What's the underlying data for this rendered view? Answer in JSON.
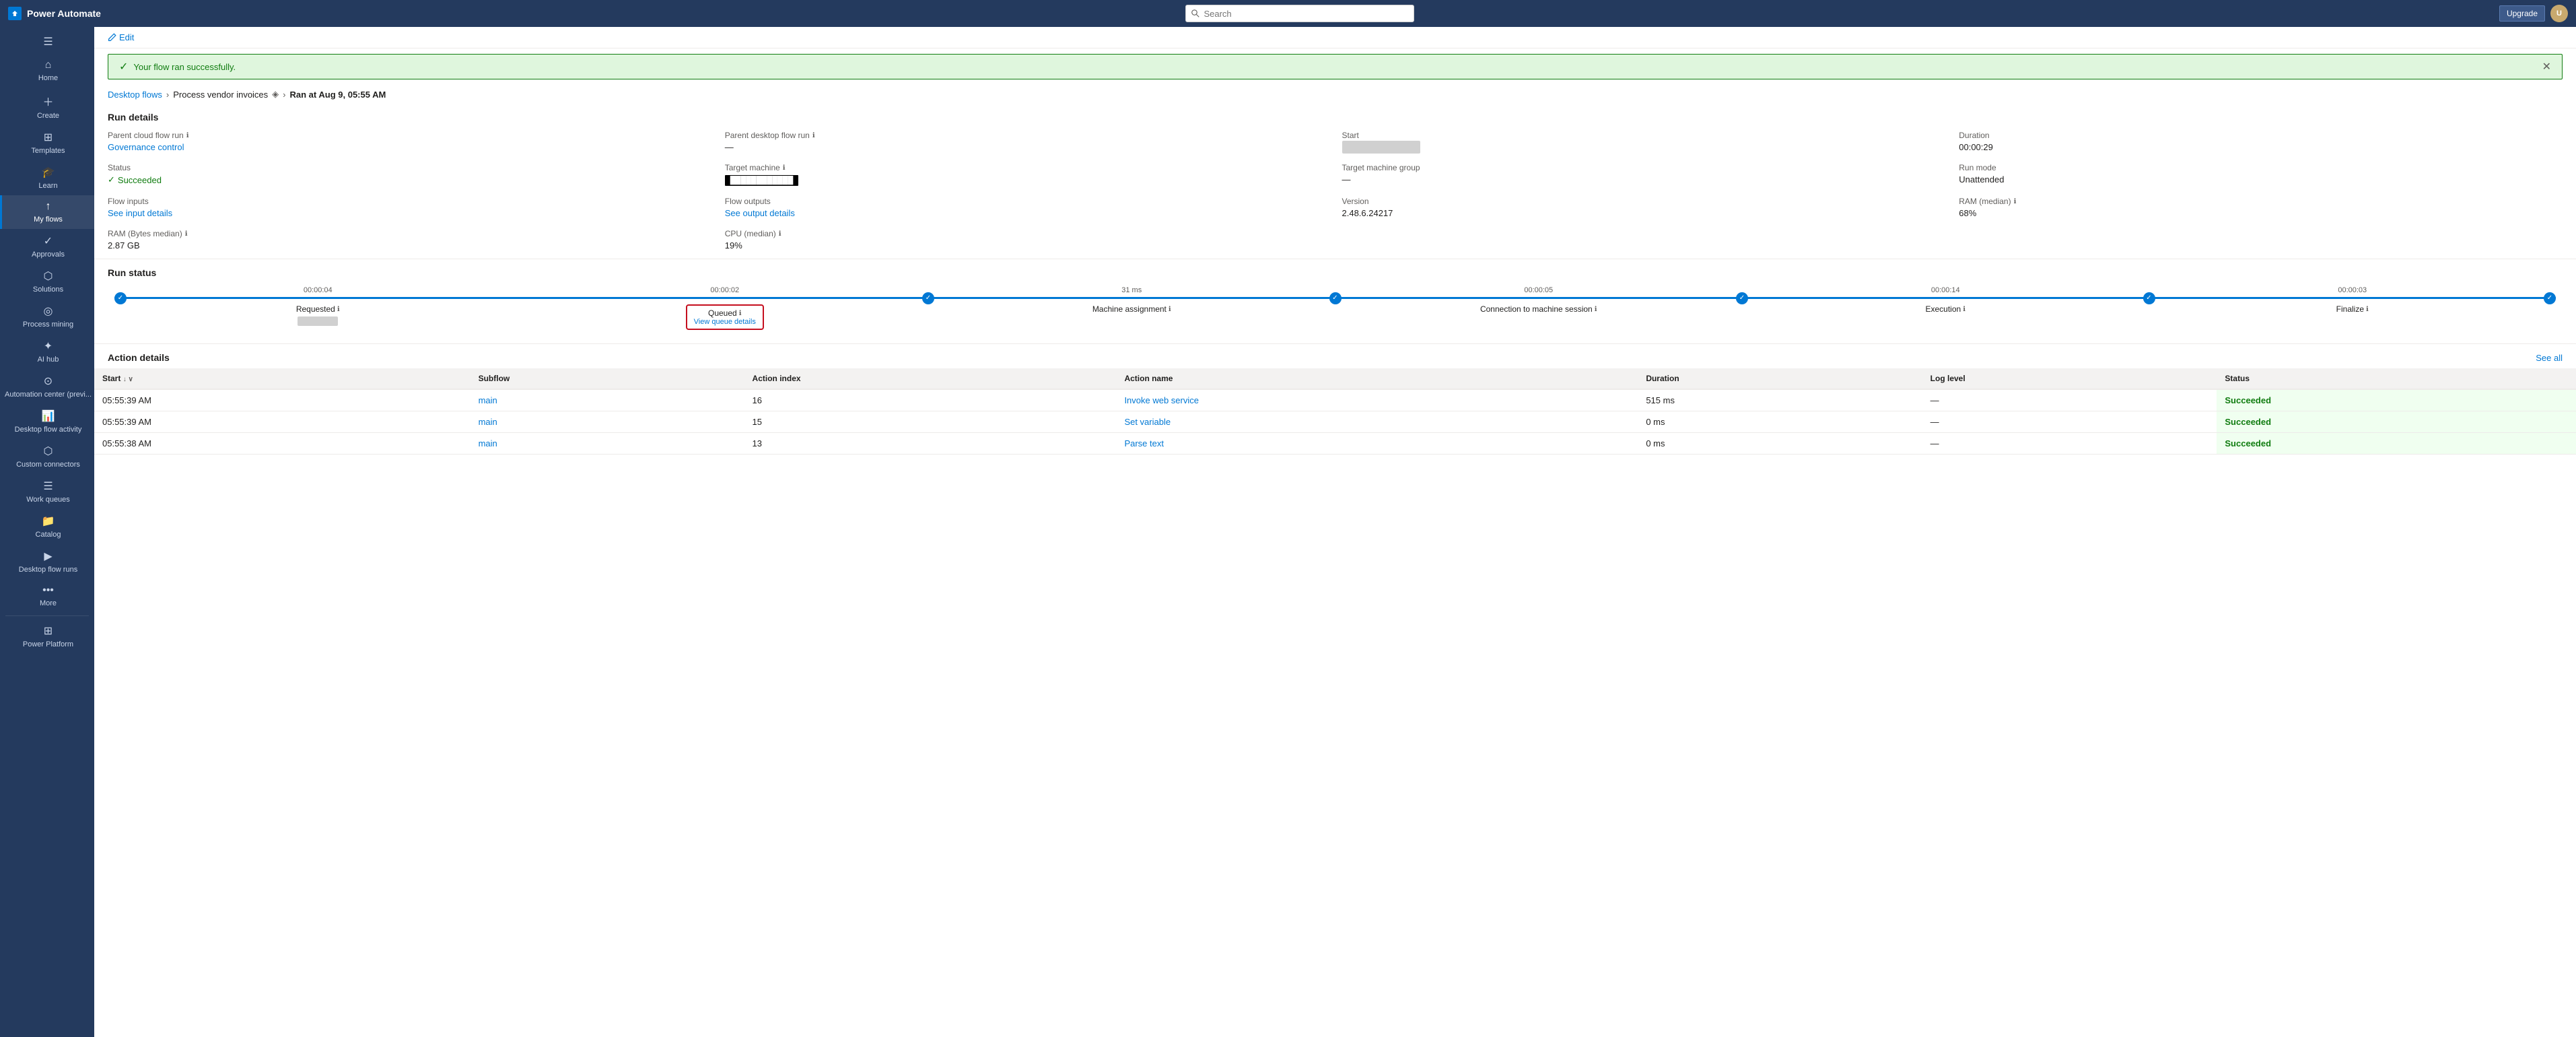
{
  "topbar": {
    "app_name": "Power Automate",
    "search_placeholder": "Search",
    "upgrade_btn": "Upgrade",
    "avatar_initials": "U"
  },
  "sidebar": {
    "items": [
      {
        "id": "menu",
        "icon": "☰",
        "label": ""
      },
      {
        "id": "home",
        "icon": "⌂",
        "label": "Home"
      },
      {
        "id": "create",
        "icon": "+",
        "label": "Create"
      },
      {
        "id": "templates",
        "icon": "⊞",
        "label": "Templates"
      },
      {
        "id": "learn",
        "icon": "🎓",
        "label": "Learn"
      },
      {
        "id": "my-flows",
        "icon": "↑",
        "label": "My flows",
        "active": true
      },
      {
        "id": "approvals",
        "icon": "✓",
        "label": "Approvals"
      },
      {
        "id": "solutions",
        "icon": "⬡",
        "label": "Solutions"
      },
      {
        "id": "process-mining",
        "icon": "◎",
        "label": "Process mining"
      },
      {
        "id": "ai-hub",
        "icon": "✦",
        "label": "AI hub"
      },
      {
        "id": "automation-center",
        "icon": "⊙",
        "label": "Automation center (previ..."
      },
      {
        "id": "desktop-flow-activity",
        "icon": "📊",
        "label": "Desktop flow activity"
      },
      {
        "id": "custom-connectors",
        "icon": "⬡",
        "label": "Custom connectors"
      },
      {
        "id": "work-queues",
        "icon": "☰",
        "label": "Work queues"
      },
      {
        "id": "catalog",
        "icon": "📁",
        "label": "Catalog"
      },
      {
        "id": "desktop-flow-runs",
        "icon": "▶",
        "label": "Desktop flow runs"
      },
      {
        "id": "more",
        "icon": "•••",
        "label": "More"
      },
      {
        "id": "power-platform",
        "icon": "⊞",
        "label": "Power Platform"
      }
    ]
  },
  "edit_bar": {
    "edit_label": "Edit"
  },
  "success_banner": {
    "message": "Your flow ran successfully."
  },
  "breadcrumb": {
    "parent": "Desktop flows",
    "flow_name": "Process vendor invoices",
    "run_label": "Ran at Aug 9, 05:55 AM"
  },
  "run_details": {
    "section_title": "Run details",
    "parent_cloud_flow_run_label": "Parent cloud flow run",
    "parent_cloud_flow_run_value": "Governance control",
    "parent_desktop_flow_run_label": "Parent desktop flow run",
    "parent_desktop_flow_run_value": "—",
    "start_label": "Start",
    "start_value": "████████████",
    "duration_label": "Duration",
    "duration_value": "00:00:29",
    "status_label": "Status",
    "status_value": "Succeeded",
    "target_machine_label": "Target machine",
    "target_machine_value": "████████████",
    "target_machine_group_label": "Target machine group",
    "target_machine_group_value": "—",
    "run_mode_label": "Run mode",
    "run_mode_value": "Unattended",
    "flow_inputs_label": "Flow inputs",
    "flow_inputs_link": "See input details",
    "flow_outputs_label": "Flow outputs",
    "flow_outputs_link": "See output details",
    "version_label": "Version",
    "version_value": "2.48.6.24217",
    "ram_median_label": "RAM (median)",
    "ram_median_value": "68%",
    "ram_bytes_label": "RAM (Bytes median)",
    "ram_bytes_value": "2.87 GB",
    "cpu_label": "CPU (median)",
    "cpu_value": "19%"
  },
  "run_status": {
    "section_title": "Run status",
    "steps": [
      {
        "id": "requested",
        "label": "Requested",
        "time": "00:00:04",
        "has_sublabel": false,
        "sublabel": ""
      },
      {
        "id": "queued",
        "label": "Queued",
        "time": "00:00:02",
        "has_sublabel": true,
        "sublabel": "View queue details",
        "highlight": true
      },
      {
        "id": "machine-assignment",
        "label": "Machine assignment",
        "time": "31 ms",
        "has_sublabel": false,
        "sublabel": ""
      },
      {
        "id": "connection",
        "label": "Connection to machine session",
        "time": "00:00:05",
        "has_sublabel": false,
        "sublabel": ""
      },
      {
        "id": "execution",
        "label": "Execution",
        "time": "00:00:14",
        "has_sublabel": false,
        "sublabel": ""
      },
      {
        "id": "finalize",
        "label": "Finalize",
        "time": "00:00:03",
        "has_sublabel": false,
        "sublabel": ""
      }
    ]
  },
  "action_details": {
    "section_title": "Action details",
    "see_all_label": "See all",
    "columns": [
      {
        "id": "start",
        "label": "Start",
        "sortable": true
      },
      {
        "id": "subflow",
        "label": "Subflow",
        "sortable": false
      },
      {
        "id": "action-index",
        "label": "Action index",
        "sortable": false
      },
      {
        "id": "action-name",
        "label": "Action name",
        "sortable": false
      },
      {
        "id": "duration",
        "label": "Duration",
        "sortable": false
      },
      {
        "id": "log-level",
        "label": "Log level",
        "sortable": false
      },
      {
        "id": "status",
        "label": "Status",
        "sortable": false
      }
    ],
    "rows": [
      {
        "start": "05:55:39 AM",
        "subflow": "main",
        "action_index": "16",
        "action_name": "Invoke web service",
        "duration": "515 ms",
        "log_level": "—",
        "status": "Succeeded"
      },
      {
        "start": "05:55:39 AM",
        "subflow": "main",
        "action_index": "15",
        "action_name": "Set variable",
        "duration": "0 ms",
        "log_level": "—",
        "status": "Succeeded"
      },
      {
        "start": "05:55:38 AM",
        "subflow": "main",
        "action_index": "13",
        "action_name": "Parse text",
        "duration": "0 ms",
        "log_level": "—",
        "status": "Succeeded"
      }
    ]
  }
}
